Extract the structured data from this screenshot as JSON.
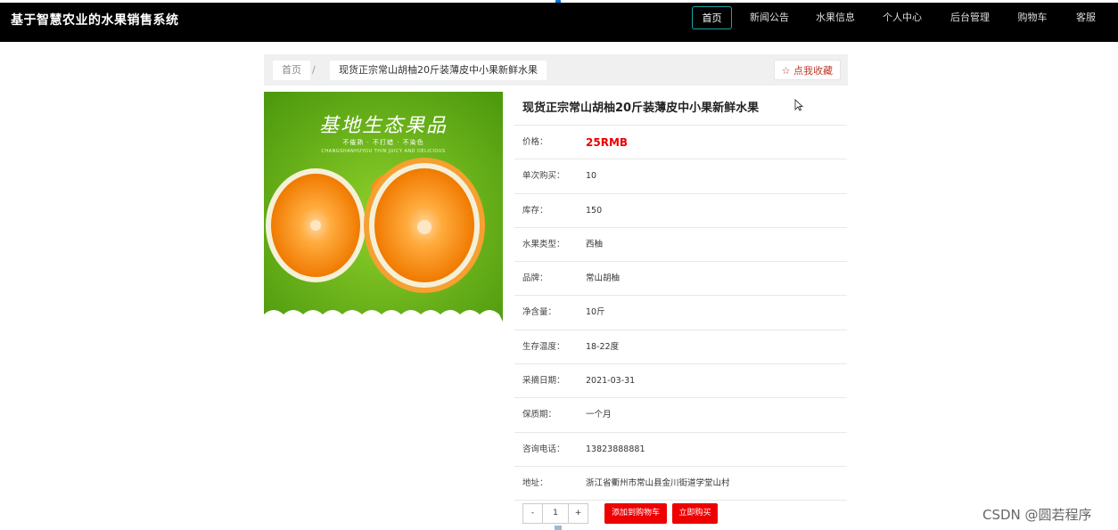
{
  "header": {
    "site_title": "基于智慧农业的水果销售系统",
    "nav": [
      {
        "label": "首页",
        "active": true
      },
      {
        "label": "新闻公告"
      },
      {
        "label": "水果信息"
      },
      {
        "label": "个人中心"
      },
      {
        "label": "后台管理"
      },
      {
        "label": "购物车"
      },
      {
        "label": "客服"
      }
    ]
  },
  "breadcrumb": {
    "home": "首页",
    "separator": "/",
    "current": "现货正宗常山胡柚20斤装薄皮中小果新鲜水果",
    "favorite": "☆ 点我收藏"
  },
  "image": {
    "title": "基地生态果品",
    "subtitle": "不催熟 · 不打蜡 · 不染色",
    "subtitle_en": "CHANGSHANHUYOU THIN JUICY AND DELICIOUS"
  },
  "product": {
    "title": "现货正宗常山胡柚20斤装薄皮中小果新鲜水果",
    "fields": [
      {
        "label": "价格：",
        "value": "25RMB"
      },
      {
        "label": "单次购买：",
        "value": "10"
      },
      {
        "label": "库存：",
        "value": "150"
      },
      {
        "label": "水果类型：",
        "value": "西柚"
      },
      {
        "label": "品牌：",
        "value": "常山胡柚"
      },
      {
        "label": "净含量：",
        "value": "10斤"
      },
      {
        "label": "生存温度：",
        "value": "18-22度"
      },
      {
        "label": "采摘日期：",
        "value": "2021-03-31"
      },
      {
        "label": "保质期：",
        "value": "一个月"
      },
      {
        "label": "咨询电话：",
        "value": "13823888881"
      },
      {
        "label": "地址：",
        "value": "浙江省衢州市常山县金川街道学堂山村"
      }
    ]
  },
  "actions": {
    "minus": "-",
    "quantity": "1",
    "plus": "+",
    "add_to_cart": "添加到购物车",
    "buy_now": "立即购买"
  },
  "watermark": "CSDN @圆若程序",
  "colors": {
    "accent": "#1aa6a6",
    "danger": "#ee0000",
    "header_bg": "#000000"
  }
}
